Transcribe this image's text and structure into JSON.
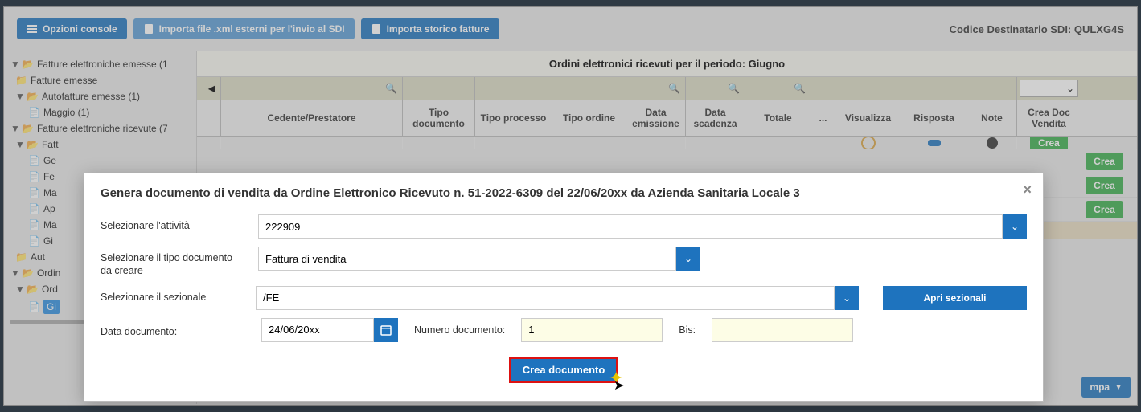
{
  "toolbar": {
    "opzioni": "Opzioni console",
    "importa_xml": "Importa file .xml esterni per l'invio al SDI",
    "importa_storico": "Importa storico fatture",
    "sdi_label": "Codice Destinatario SDI: QULXG4S"
  },
  "tree": {
    "fee": "Fatture elettroniche emesse (1",
    "fem": "Fatture emesse",
    "afe": "Autofatture emesse (1)",
    "maggio": "Maggio (1)",
    "fer": "Fatture elettroniche ricevute (7",
    "fatt": "Fatt",
    "ge": "Ge",
    "fe2": "Fe",
    "ma1": "Ma",
    "ap": "Ap",
    "ma2": "Ma",
    "gi1": "Gi",
    "aut": "Aut",
    "ordin": "Ordin",
    "ord": "Ord",
    "gi_sel": "Gi"
  },
  "panel": {
    "title": "Ordini elettronici ricevuti per il periodo: Giugno"
  },
  "columns": {
    "ced": "Cedente/Prestatore",
    "tipo": "Tipo documento",
    "proc": "Tipo processo",
    "ord": "Tipo ordine",
    "de": "Data emissione",
    "ds": "Data scadenza",
    "tot": "Totale",
    "dots": "...",
    "vis": "Visualizza",
    "risp": "Risposta",
    "note": "Note",
    "crea": "Crea Doc Vendita"
  },
  "row_partial": {
    "ced_frag": "",
    "tipo_frag": "",
    "proc_frag": "",
    "ord_frag": "",
    "de_frag": "",
    "ds_frag": "",
    "tot_frag": "",
    "risp_frag": ""
  },
  "crea_btn": "Crea",
  "print_btn": "mpa",
  "modal": {
    "title": "Genera documento di vendita da Ordine Elettronico Ricevuto n. 51-2022-6309 del 22/06/20xx da Azienda Sanitaria Locale 3",
    "label_attivita": "Selezionare l'attività",
    "val_attivita": "222909",
    "label_tipodoc": "Selezionare il tipo documento da creare",
    "val_tipodoc": "Fattura di vendita",
    "label_sezionale": "Selezionare il sezionale",
    "val_sezionale": "/FE",
    "apri": "Apri sezionali",
    "label_data": "Data documento:",
    "val_data": "24/06/20xx",
    "label_num": "Numero documento:",
    "val_num": "1",
    "label_bis": "Bis:",
    "val_bis": "",
    "crea_doc": "Crea documento"
  },
  "chart_data": null
}
